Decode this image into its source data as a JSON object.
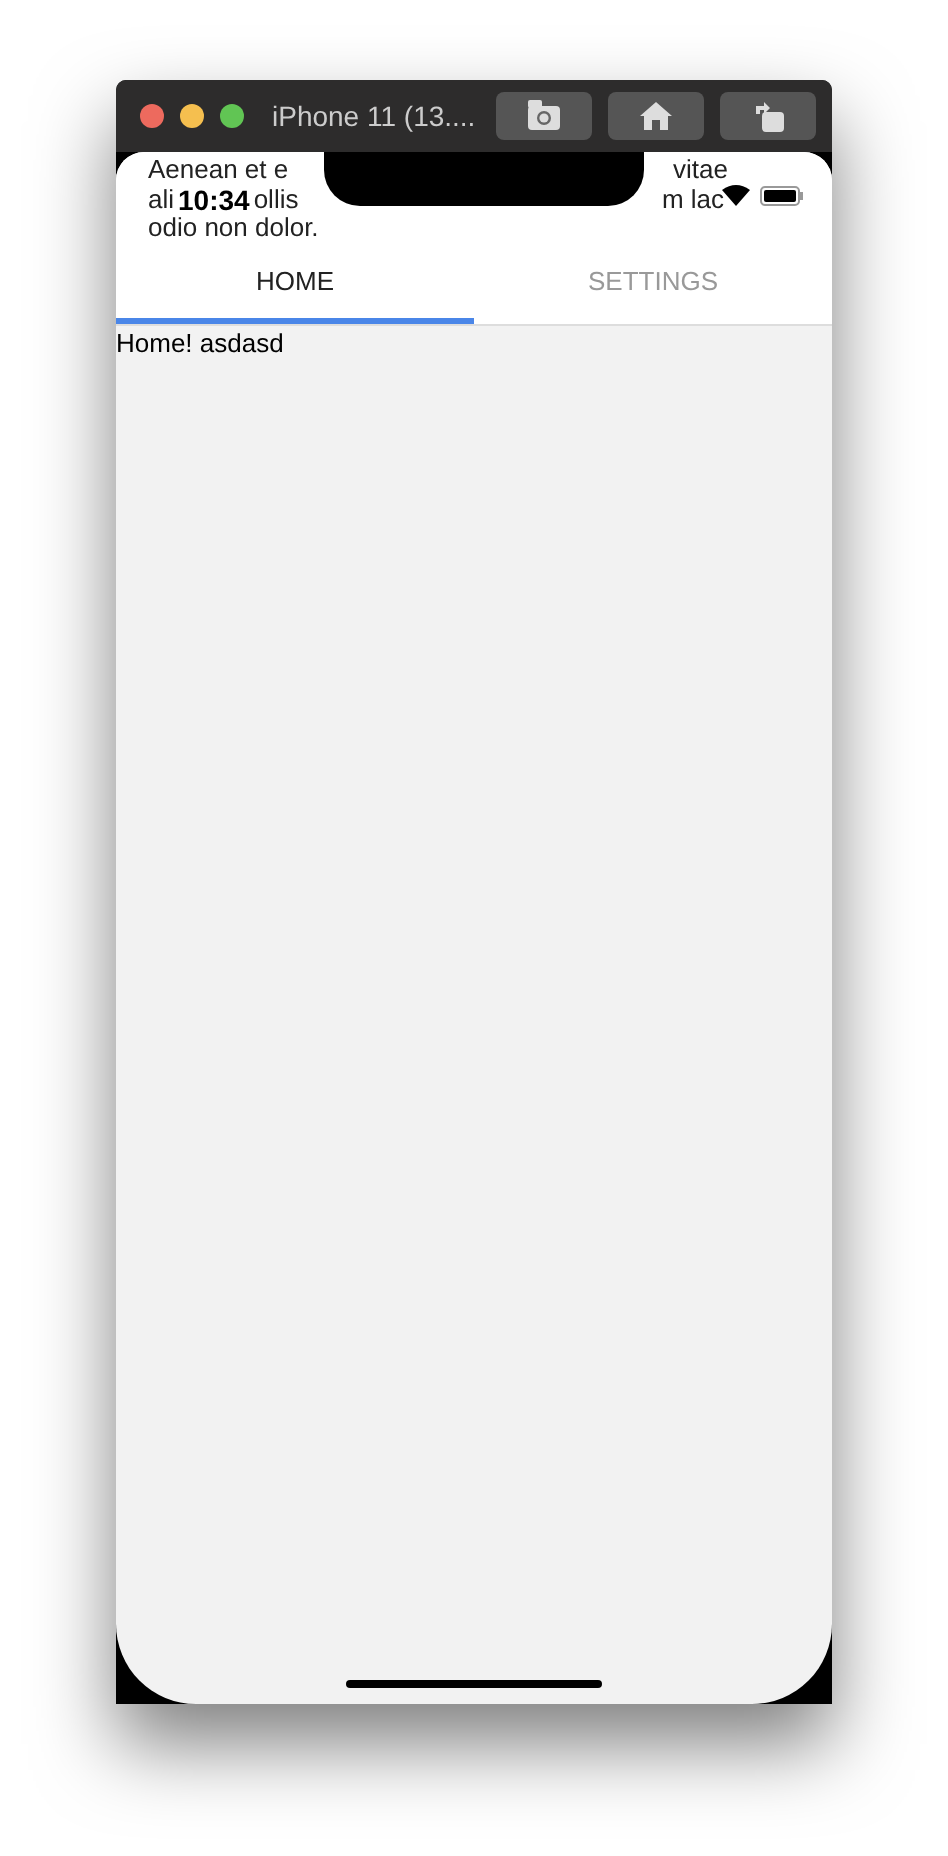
{
  "window": {
    "title": "iPhone 11 (13...."
  },
  "toolbar": [
    {
      "kind": "camera"
    },
    {
      "kind": "home"
    },
    {
      "kind": "rotate"
    }
  ],
  "status_bar": {
    "time": "10:34"
  },
  "background_text": [
    {
      "left": "Aenean et e",
      "right": "vitae"
    },
    {
      "left": "ali",
      "middle": "ollis",
      "right": "m lac"
    },
    {
      "left": "odio non dolor."
    }
  ],
  "tabs": [
    {
      "label": "HOME",
      "selected": true
    },
    {
      "label": "SETTINGS",
      "selected": false
    }
  ],
  "content": {
    "text": "Home! asdasd"
  }
}
